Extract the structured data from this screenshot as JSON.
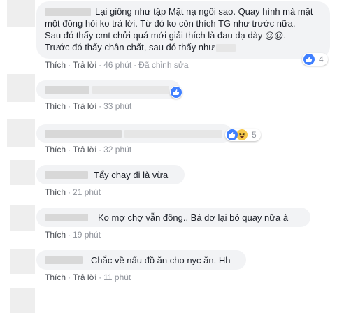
{
  "comments": [
    {
      "lines": [
        "Lại giống như tập Mặt nạ ngôi sao. Quay hình mà mặt",
        "một đống hỏi ko trả lời. Từ đó ko còn thích TG như trước nữa.",
        "Sau đó thấy cmt chửi quá mới giải thích là đau dạ dày @@.",
        "Trước đó thấy chân chất, sau đó thấy như"
      ],
      "like": "Thích",
      "reply": "Trả lời",
      "time": "46 phút",
      "edited": "Đã chỉnh sửa",
      "reaction_count": "4"
    },
    {
      "like": "Thích",
      "reply": "Trả lời",
      "time": "33 phút"
    },
    {
      "like": "Thích",
      "reply": "Trả lời",
      "time": "32 phút",
      "reaction_count": "5"
    },
    {
      "text": "Tẩy chay đi là vừa",
      "like": "Thích",
      "time": "21 phút"
    },
    {
      "text": "Ko mợ chợ vẫn đông.. Bá dơ lại bỏ quay nữa à",
      "like": "Thích",
      "time": "19 phút"
    },
    {
      "text": "Chắc về nấu đồ ăn cho nyc ăn. Hh",
      "like": "Thích",
      "reply": "Trả lời",
      "time": "11 phút"
    }
  ],
  "icons": {
    "like": "thumbs-up-icon",
    "haha": "haha-emoji-icon"
  },
  "colors": {
    "like_blue": "#4080ff",
    "bubble_bg": "#f2f3f5",
    "meta_gray": "#90949c"
  }
}
